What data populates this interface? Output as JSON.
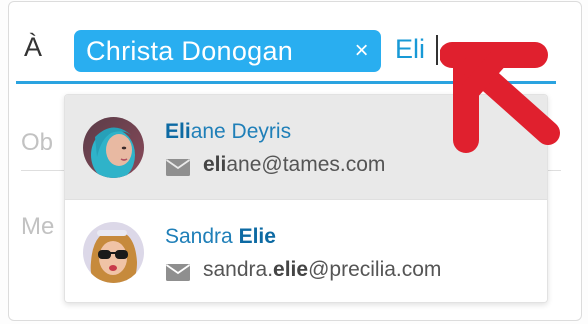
{
  "to_field": {
    "label": "À",
    "chips": [
      {
        "name": "Christa Donogan",
        "remove_symbol": "×"
      }
    ],
    "input_value": "Eli"
  },
  "subject_field": {
    "placeholder": "Ob"
  },
  "message_field": {
    "placeholder": "Me"
  },
  "suggestions": [
    {
      "name_match": "Eli",
      "name_rest": "ane Deyris",
      "email_match": "eli",
      "email_rest": "ane@tames.com",
      "highlighted": true
    },
    {
      "name_prefix": "Sandra ",
      "name_match": "Elie",
      "email_prefix": "sandra.",
      "email_match": "elie",
      "email_rest": "@precilia.com",
      "highlighted": false
    }
  ],
  "colors": {
    "accent": "#29aef0",
    "pointer_arrow": "#e0202e",
    "highlight_row": "#e9e9e9"
  },
  "icons": {
    "mail": "mail-icon",
    "pointer": "red-arrow-pointer"
  }
}
